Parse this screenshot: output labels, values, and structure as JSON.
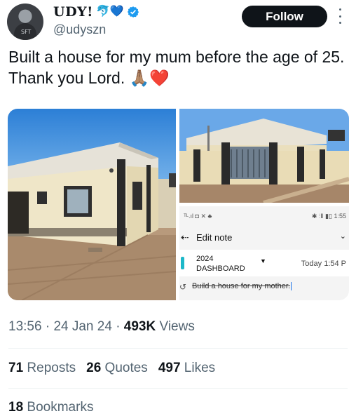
{
  "author": {
    "display_name": "UDY!",
    "emoji": "🐬💙",
    "handle": "@udyszn",
    "avatar_tag": "SFT"
  },
  "follow_label": "Follow",
  "tweet": {
    "text": "Built a house for my mum before the age of 25. Thank you Lord.",
    "emoji": "🙏🏽❤️"
  },
  "note_screenshot": {
    "status_left": "ᵀᴸ.ıl ◘ ✕ ♣",
    "status_right": "✱ ⫶Ⅱ ▮▯ 1:55",
    "title": "Edit note",
    "folder_year": "2024",
    "folder_name": "DASHBOARD",
    "date": "Today 1:54 P",
    "body": "Build a house for my mother."
  },
  "meta": {
    "time": "13:56",
    "date": "24 Jan 24",
    "views_count": "493K",
    "views_label": "Views"
  },
  "stats": {
    "reposts_count": "71",
    "reposts_label": "Reposts",
    "quotes_count": "26",
    "quotes_label": "Quotes",
    "likes_count": "497",
    "likes_label": "Likes",
    "bookmarks_count": "18",
    "bookmarks_label": "Bookmarks"
  },
  "colors": {
    "verified": "#1d9bf0",
    "muted": "#536471",
    "text": "#0f1419",
    "follow_bg": "#0f1419"
  }
}
